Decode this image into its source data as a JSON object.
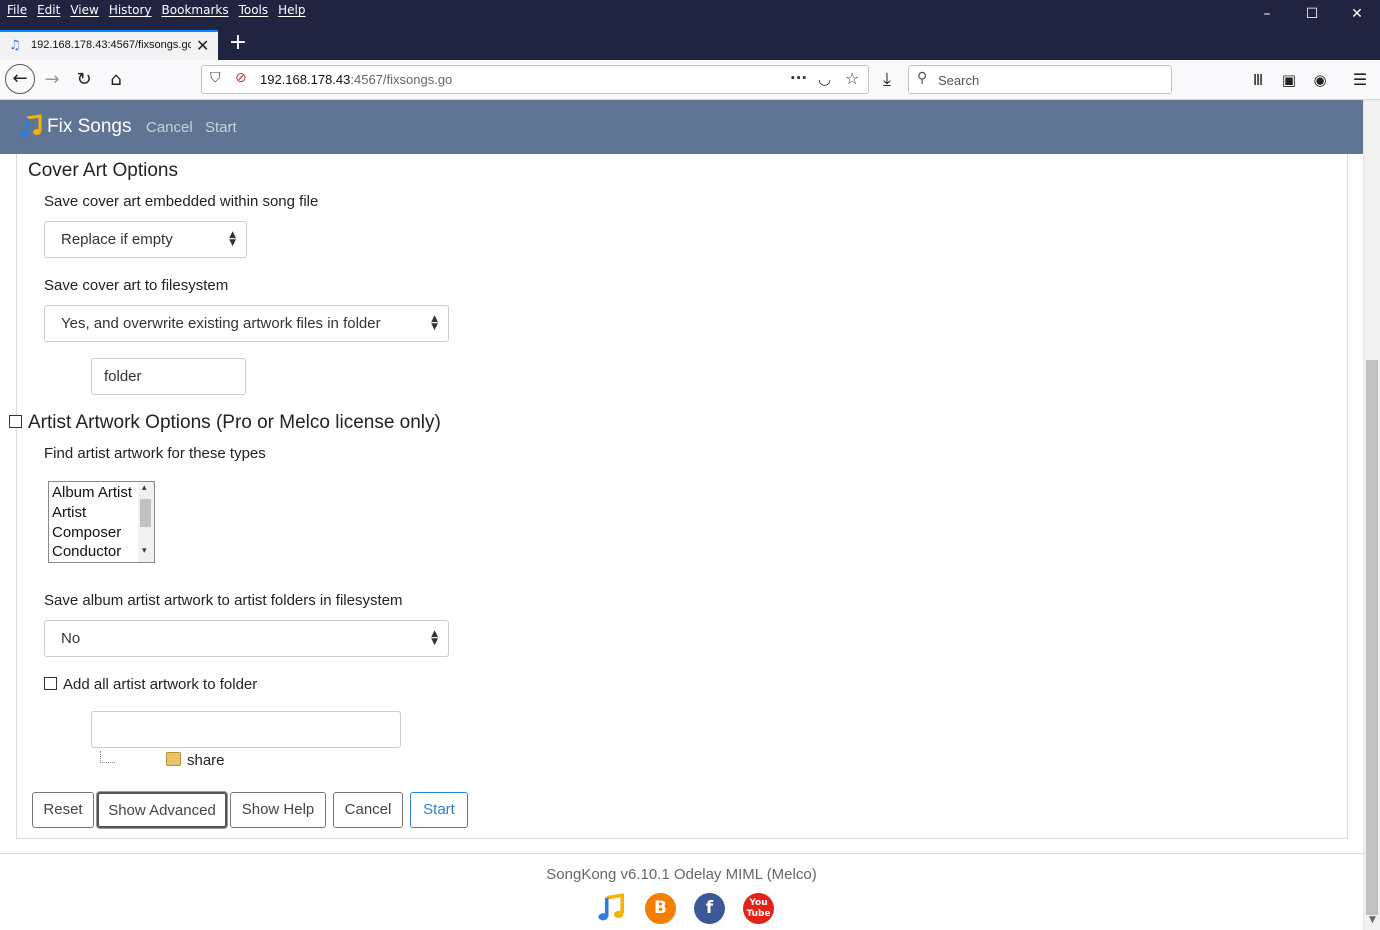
{
  "browser": {
    "menu": [
      "File",
      "Edit",
      "View",
      "History",
      "Bookmarks",
      "Tools",
      "Help"
    ],
    "window_controls": {
      "minimize": "–",
      "maximize": "☐",
      "close": "✕"
    },
    "tab_title": "192.168.178.43:4567/fixsongs.go",
    "url_host": "192.168.178.43",
    "url_rest": ":4567/fixsongs.go",
    "search_placeholder": "Search"
  },
  "app": {
    "brand": "Fix Songs",
    "nav": {
      "cancel": "Cancel",
      "start": "Start"
    }
  },
  "cover_art": {
    "title": "Cover Art Options",
    "embed_label": "Save cover art embedded within song file",
    "embed_value": "Replace if empty",
    "filesystem_label": "Save cover art to filesystem",
    "filesystem_value": "Yes, and overwrite existing artwork files in folder",
    "filename_value": "folder"
  },
  "artist_artwork": {
    "title": "Artist Artwork Options (Pro or Melco license only)",
    "checked": false,
    "types_label": "Find artist artwork for these types",
    "types": [
      "Album Artist",
      "Artist",
      "Composer",
      "Conductor"
    ],
    "save_label": "Save album artist artwork to artist folders in filesystem",
    "save_value": "No",
    "add_all_label": "Add all artist artwork to folder",
    "add_all_checked": false,
    "folder_value": "",
    "tree_item": "share"
  },
  "buttons": {
    "reset": "Reset",
    "show_advanced": "Show Advanced",
    "show_help": "Show Help",
    "cancel": "Cancel",
    "start": "Start"
  },
  "footer": {
    "version": "SongKong v6.10.1 Odelay MIML (Melco)"
  }
}
